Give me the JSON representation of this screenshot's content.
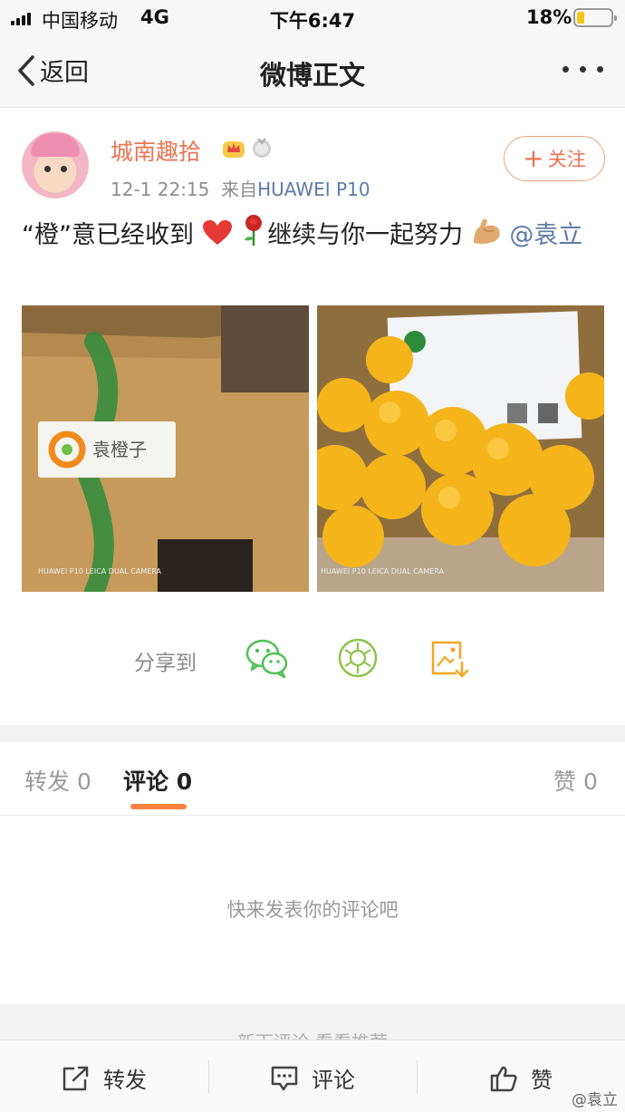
{
  "status_bar": {
    "carrier": "中国移动",
    "network": "4G",
    "time": "下午6:47",
    "battery_percent": "18%",
    "battery_level": 0.18
  },
  "nav": {
    "back_label": "返回",
    "title": "微博正文",
    "back_icon": "chevron-left-icon",
    "more_icon": "more-dots-icon"
  },
  "post": {
    "username": "城南趣拾",
    "timestamp": "12-1 22:15",
    "source_prefix": "来自",
    "source_device": "HUAWEI P10",
    "follow_label": "关注",
    "text_quote_open": "“",
    "text_quote_word": "橙",
    "text_quote_close": "”",
    "text_part1": "意已经收到",
    "text_part2": "继续与你一起努力",
    "mention": "@袁立",
    "images": [
      {
        "kind": "photo-of-package",
        "label": "袁橙子",
        "watermark": "HUAWEI P10 LEICA DUAL CAMERA"
      },
      {
        "kind": "photo-of-oranges",
        "watermark": "HUAWEI P10 LEICA DUAL CAMERA"
      }
    ]
  },
  "share": {
    "label": "分享到",
    "icons": [
      "wechat-icon",
      "moments-icon",
      "save-image-icon"
    ]
  },
  "tabs": {
    "repost_label": "转发",
    "repost_count": "0",
    "comment_label": "评论",
    "comment_count": "0",
    "like_label": "赞",
    "like_count": "0"
  },
  "comments": {
    "empty_prompt": "快来发表你的评论吧"
  },
  "more_hint": "新下评论 看看推荐",
  "toolbar": {
    "repost_label": "转发",
    "comment_label": "评论",
    "like_label": "赞",
    "watermark": "@袁立"
  },
  "colors": {
    "accent_orange": "#eb7350",
    "tab_underline": "#ff8140",
    "link_blue": "#5d7aa8",
    "wechat_green": "#4fc153"
  }
}
